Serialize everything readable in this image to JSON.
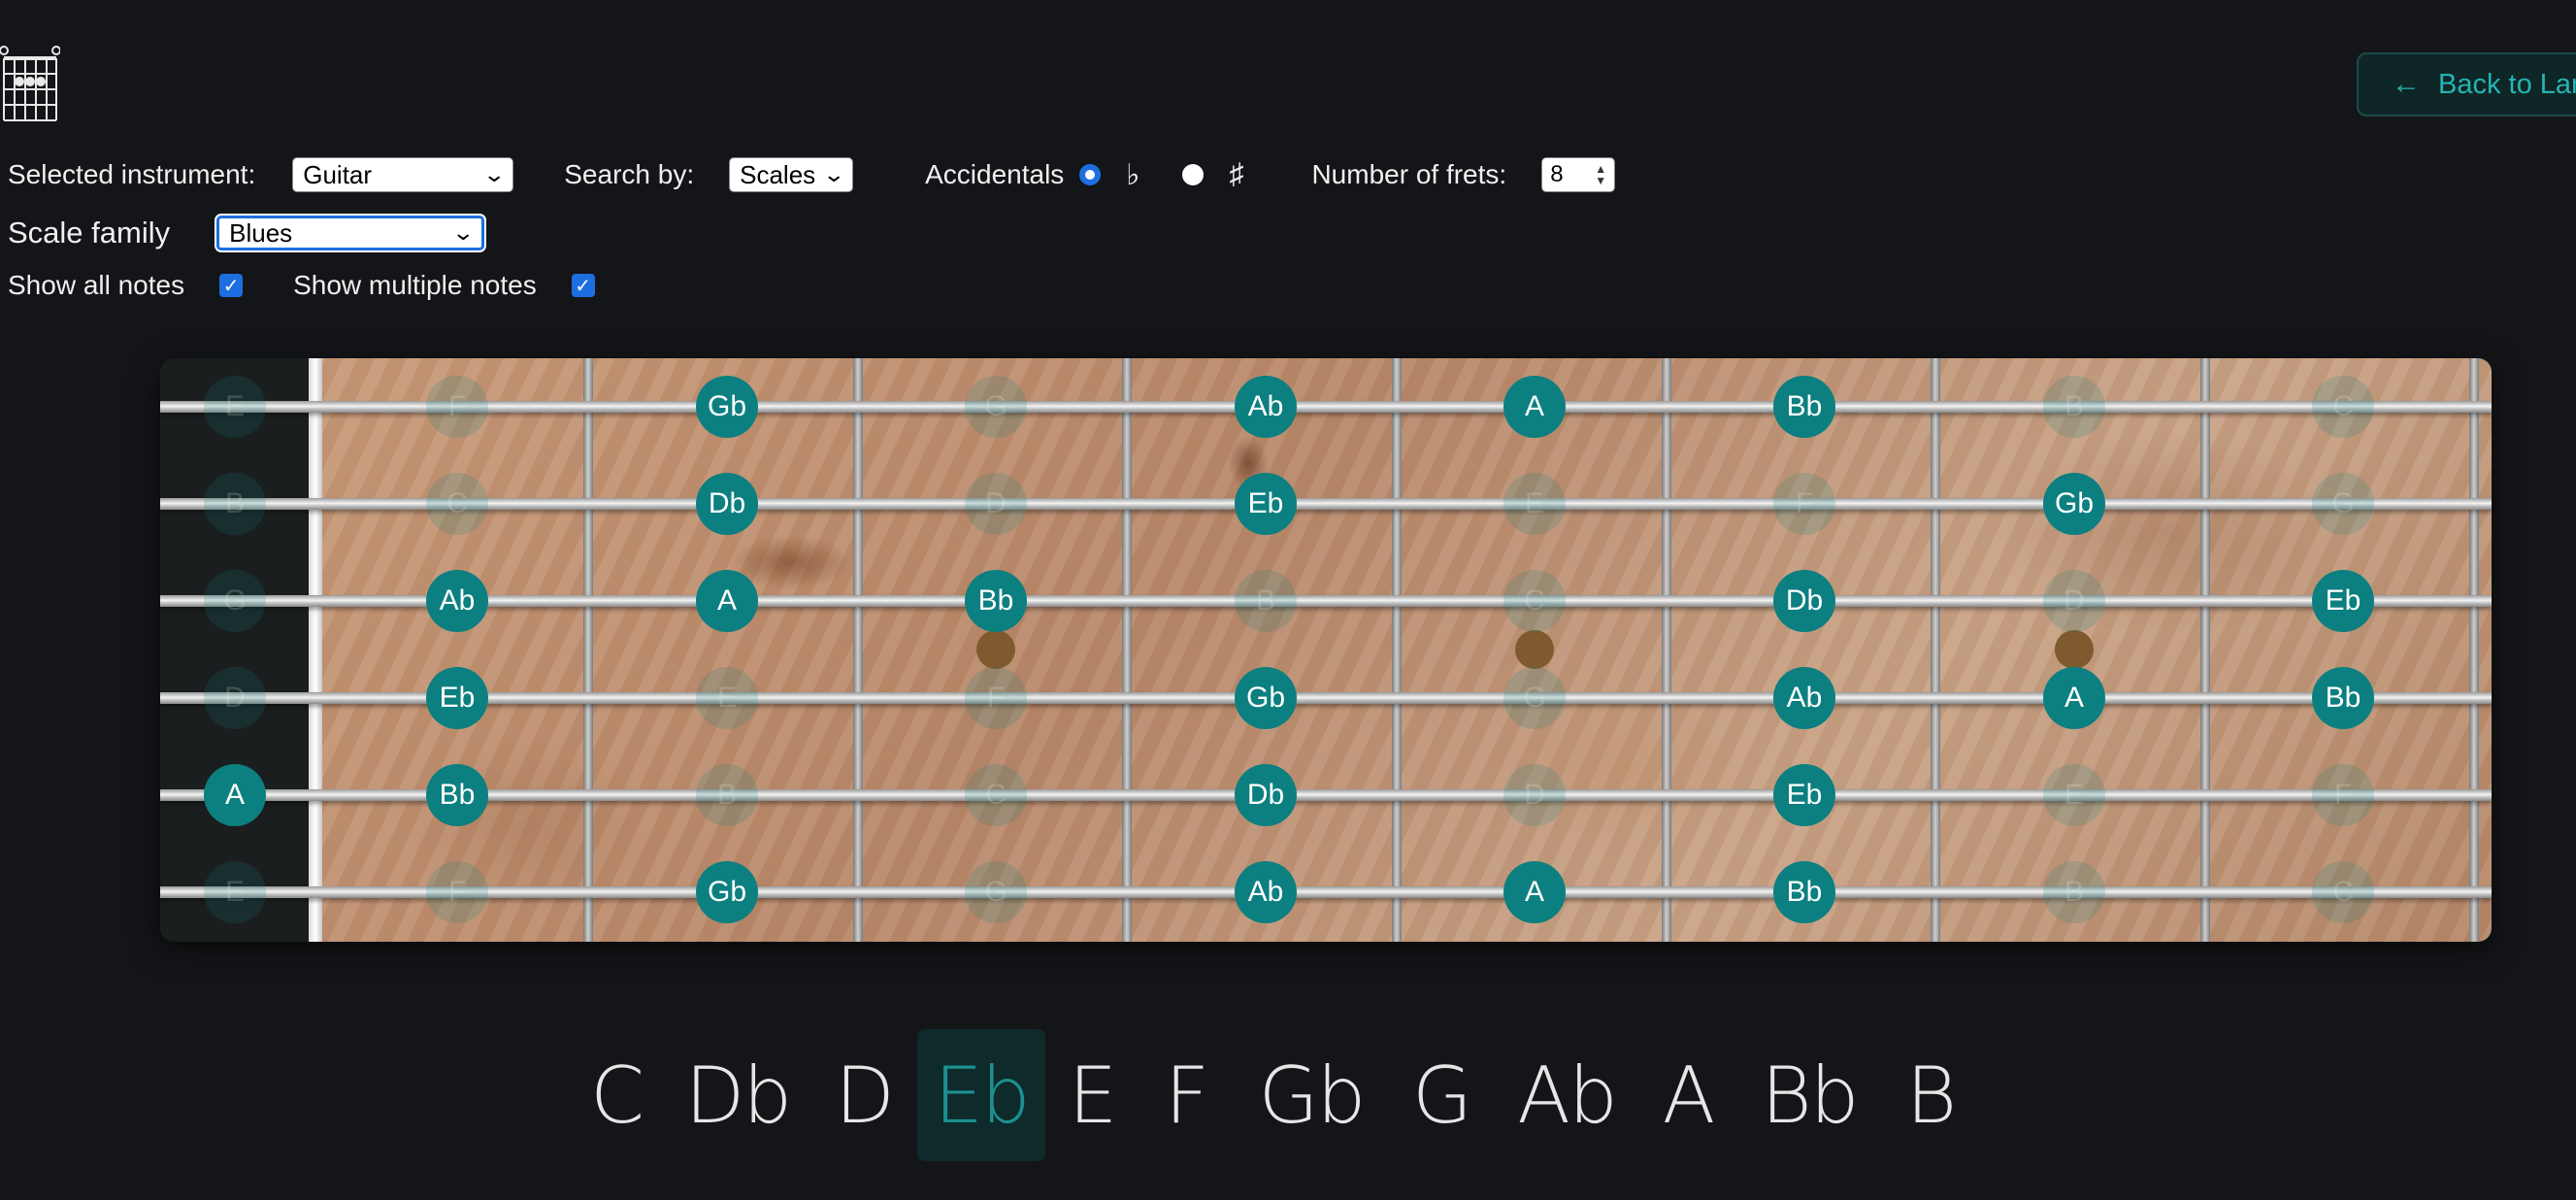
{
  "header": {
    "logo_icon": "guitar-chord-diagram-icon",
    "back_button": {
      "label": "Back to Lan",
      "icon": "arrow-left-icon"
    }
  },
  "controls": {
    "instrument_label": "Selected instrument:",
    "instrument_value": "Guitar",
    "search_by_label": "Search by:",
    "search_by_value": "Scales",
    "accidentals_label": "Accidentals",
    "flat_symbol": "♭",
    "sharp_symbol": "♯",
    "accidental_selected": "flat",
    "frets_label": "Number of frets:",
    "frets_value": "8",
    "scale_family_label": "Scale family",
    "scale_family_value": "Blues",
    "show_all_label": "Show all notes",
    "show_all_checked": true,
    "show_multiple_label": "Show multiple notes",
    "show_multiple_checked": true
  },
  "fretboard": {
    "strings": [
      {
        "notes": [
          "E",
          "F",
          "Gb",
          "G",
          "Ab",
          "A",
          "Bb",
          "B",
          "C"
        ],
        "active": [
          false,
          false,
          true,
          false,
          true,
          true,
          true,
          false,
          false
        ]
      },
      {
        "notes": [
          "B",
          "C",
          "Db",
          "D",
          "Eb",
          "E",
          "F",
          "Gb",
          "G"
        ],
        "active": [
          false,
          false,
          true,
          false,
          true,
          false,
          false,
          true,
          false
        ]
      },
      {
        "notes": [
          "G",
          "Ab",
          "A",
          "Bb",
          "B",
          "C",
          "Db",
          "D",
          "Eb"
        ],
        "active": [
          false,
          true,
          true,
          true,
          false,
          false,
          true,
          false,
          true
        ]
      },
      {
        "notes": [
          "D",
          "Eb",
          "E",
          "F",
          "Gb",
          "G",
          "Ab",
          "A",
          "Bb"
        ],
        "active": [
          false,
          true,
          false,
          false,
          true,
          false,
          true,
          true,
          true
        ]
      },
      {
        "notes": [
          "A",
          "Bb",
          "B",
          "C",
          "Db",
          "D",
          "Eb",
          "E",
          "F"
        ],
        "active": [
          true,
          true,
          false,
          false,
          true,
          false,
          true,
          false,
          false
        ]
      },
      {
        "notes": [
          "E",
          "F",
          "Gb",
          "G",
          "Ab",
          "A",
          "Bb",
          "B",
          "C"
        ],
        "active": [
          false,
          false,
          true,
          false,
          true,
          true,
          true,
          false,
          false
        ]
      }
    ],
    "inlay_frets": [
      3,
      5,
      7
    ],
    "colors": {
      "note": "#0c7f80",
      "inlay": "#7e5a2e"
    }
  },
  "key_selector": {
    "keys": [
      "C",
      "Db",
      "D",
      "Eb",
      "E",
      "F",
      "Gb",
      "G",
      "Ab",
      "A",
      "Bb",
      "B"
    ],
    "selected": "Eb",
    "accent": "#1d8f90"
  }
}
